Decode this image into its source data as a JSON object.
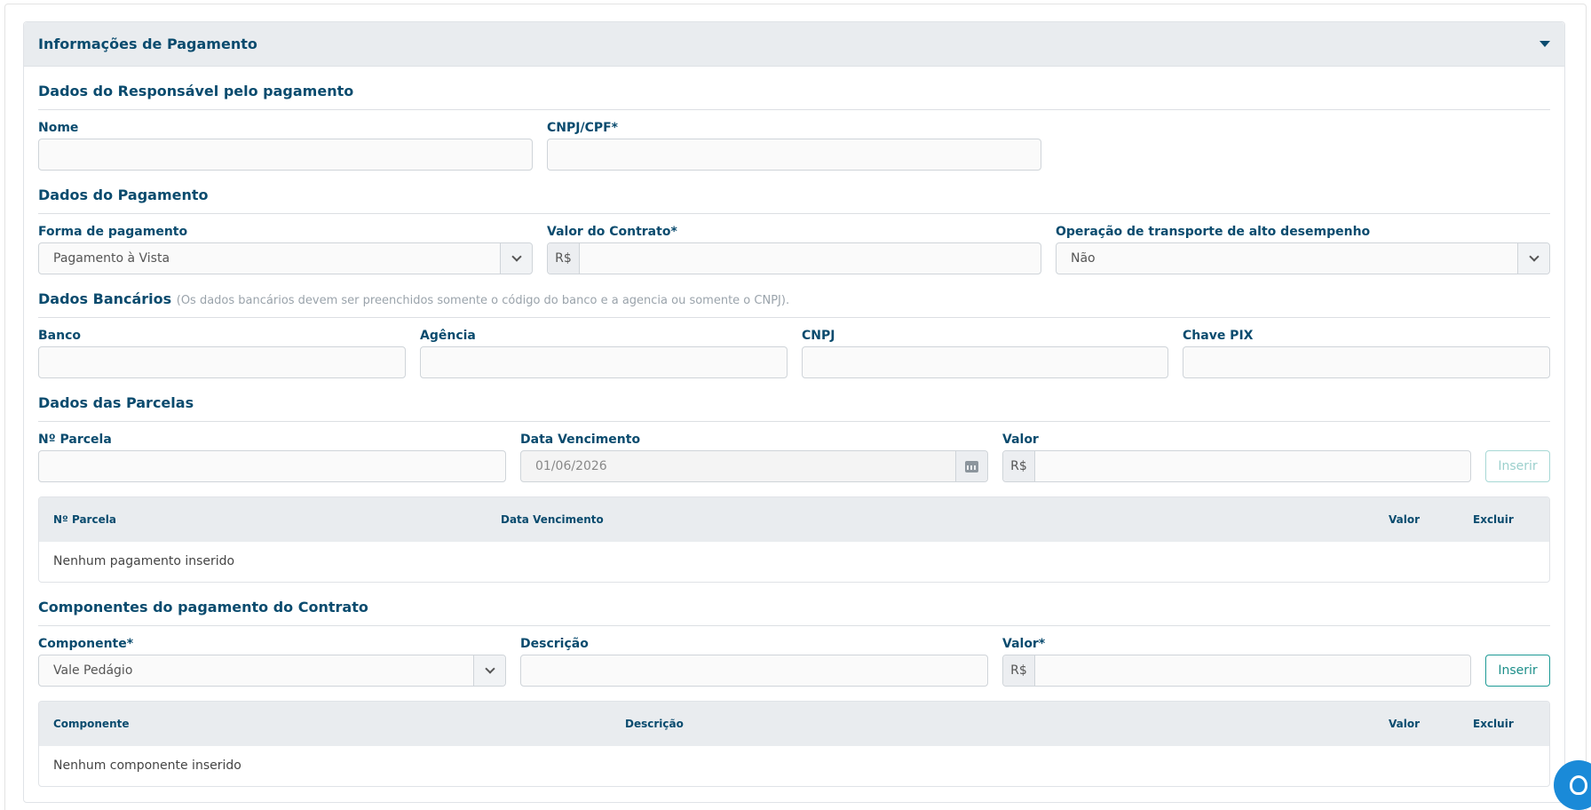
{
  "panel": {
    "title": "Informações de Pagamento"
  },
  "responsavel": {
    "title": "Dados do Responsável pelo pagamento",
    "nome_label": "Nome",
    "nome_value": "",
    "cnpjcpf_label": "CNPJ/CPF*",
    "cnpjcpf_value": ""
  },
  "pagamento": {
    "title": "Dados do Pagamento",
    "forma_label": "Forma de pagamento",
    "forma_value": "Pagamento à Vista",
    "valor_label": "Valor do Contrato*",
    "currency": "R$",
    "valor_value": "",
    "operacao_label": "Operação de transporte de alto desempenho",
    "operacao_value": "Não"
  },
  "bancarios": {
    "title": "Dados Bancários",
    "note": "(Os dados bancários devem ser preenchidos somente o código do banco e a agencia ou somente o CNPJ).",
    "banco_label": "Banco",
    "agencia_label": "Agência",
    "cnpj_label": "CNPJ",
    "pix_label": "Chave PIX"
  },
  "parcelas": {
    "title": "Dados das Parcelas",
    "num_label": "Nº Parcela",
    "data_label": "Data Vencimento",
    "data_value": "01/06/2026",
    "valor_label": "Valor",
    "currency": "R$",
    "insert_label": "Inserir",
    "table": {
      "columns": [
        "Nº Parcela",
        "Data Vencimento",
        "Valor",
        "Excluir"
      ],
      "empty": "Nenhum pagamento inserido"
    }
  },
  "componentes": {
    "title": "Componentes do pagamento do Contrato",
    "comp_label": "Componente*",
    "comp_value": "Vale Pedágio",
    "desc_label": "Descrição",
    "valor_label": "Valor*",
    "currency": "R$",
    "insert_label": "Inserir",
    "table": {
      "columns": [
        "Componente",
        "Descrição",
        "Valor",
        "Excluir"
      ],
      "empty": "Nenhum componente inserido"
    }
  },
  "icons": {
    "collapse": "caret-down-icon",
    "select": "chevron-down-icon",
    "calendar": "calendar-icon",
    "support": "support-agent-icon"
  },
  "colors": {
    "primary_text": "#0a4b6e",
    "accent": "#1d9a95",
    "header_bg": "#e9ecef",
    "fab": "#1a8ad8"
  }
}
